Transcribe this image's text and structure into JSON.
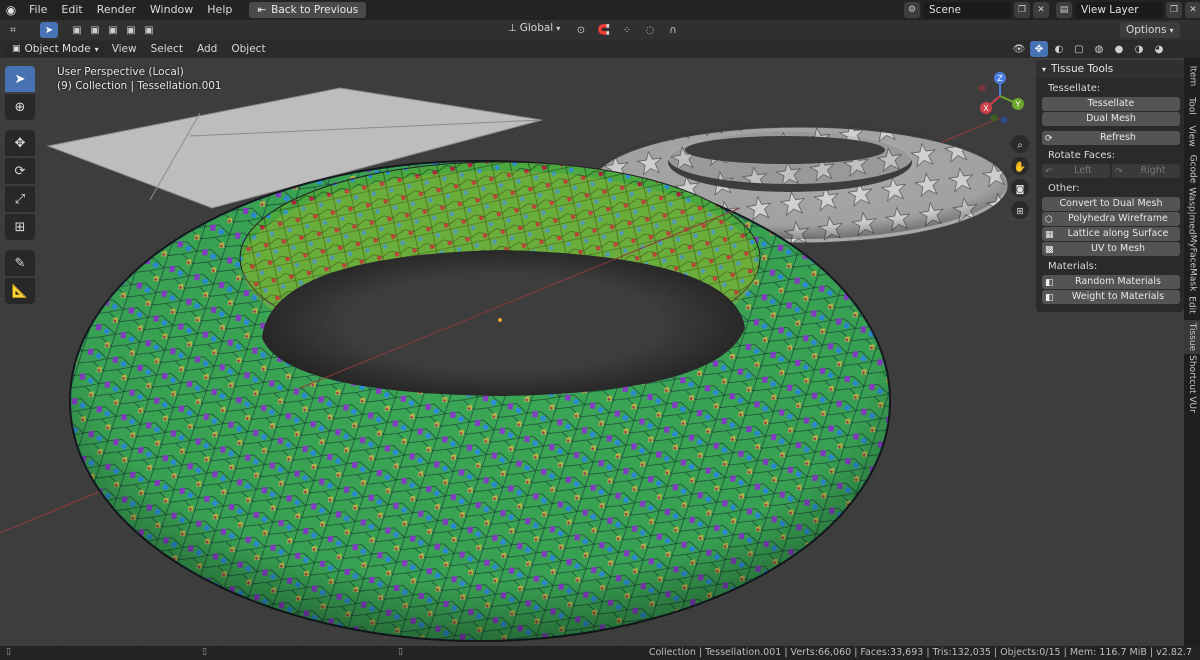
{
  "topbar": {
    "menus": [
      "File",
      "Edit",
      "Render",
      "Window",
      "Help"
    ],
    "back_button": "Back to Previous",
    "scene": "Scene",
    "view_layer": "View Layer"
  },
  "header": {
    "orientation": "Global",
    "options": "Options",
    "mode": "Object Mode",
    "menus": [
      "View",
      "Select",
      "Add",
      "Object"
    ]
  },
  "viewport": {
    "perspective": "User Perspective (Local)",
    "collection": "(9) Collection | Tessellation.001",
    "gizmo_axes": [
      "X",
      "Y",
      "Z"
    ]
  },
  "panel": {
    "title": "Tissue Tools",
    "tessellate_label": "Tessellate:",
    "tessellate_btn": "Tessellate",
    "dual_mesh_btn": "Dual Mesh",
    "refresh_btn": "Refresh",
    "rotate_label": "Rotate Faces:",
    "left_btn": "Left",
    "right_btn": "Right",
    "other_label": "Other:",
    "convert_btn": "Convert to Dual Mesh",
    "polyhedra_btn": "Polyhedra Wireframe",
    "lattice_btn": "Lattice along Surface",
    "uv_btn": "UV to Mesh",
    "materials_label": "Materials:",
    "random_btn": "Random Materials",
    "weight_btn": "Weight to Materials"
  },
  "side_tabs": [
    "Item",
    "Tool",
    "View",
    "Gcode",
    "Wasp|med",
    "MyFaceMask",
    "Edit",
    "Tissue",
    "Shortcut VUr"
  ],
  "status": {
    "text": "Collection | Tessellation.001 | Verts:66,060 | Faces:33,693 | Tris:132,035 | Objects:0/15 | Mem: 116.7 MiB | v2.82.7"
  },
  "colors": {
    "accent": "#4772b3",
    "torus_green": "#3fae3a",
    "torus_blue": "#2c8fd8",
    "torus_yellow": "#d9c22b",
    "torus_red": "#b0233e",
    "torus_purple": "#9b2cc4",
    "white_torus": "#bdbdbd"
  }
}
